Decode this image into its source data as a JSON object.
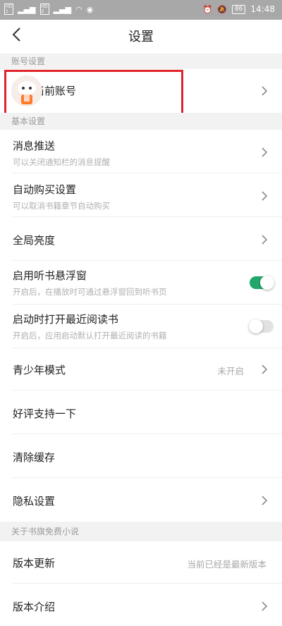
{
  "status_bar": {
    "hd1": "HD",
    "hd1_sub": "1",
    "hd2": "HD",
    "hd2_sub": "2",
    "signal1": "4G",
    "battery": "86",
    "time": "14:48"
  },
  "header": {
    "title": "设置"
  },
  "sections": {
    "account": "账号设置",
    "basic": "基本设置",
    "about": "关于书旗免费小说"
  },
  "account": {
    "logout_label": "退出当前账号"
  },
  "settings": {
    "push": {
      "label": "消息推送",
      "sub": "可以关闭通知栏的消息提醒"
    },
    "autobuy": {
      "label": "自动购买设置",
      "sub": "可以取消书籍章节自动购买"
    },
    "brightness": {
      "label": "全局亮度"
    },
    "float": {
      "label": "启用听书悬浮窗",
      "sub": "开启后，在播放时可通过悬浮窗回到听书页",
      "on": true
    },
    "recent": {
      "label": "启动时打开最近阅读书",
      "sub": "开启后，应用启动默认打开最近阅读的书籍",
      "on": false
    },
    "teen": {
      "label": "青少年模式",
      "value": "未开启"
    },
    "rate": {
      "label": "好评支持一下"
    },
    "cache": {
      "label": "清除缓存"
    },
    "privacy": {
      "label": "隐私设置"
    }
  },
  "about": {
    "update": {
      "label": "版本更新",
      "value": "当前已经是最新版本"
    },
    "intro": {
      "label": "版本介绍"
    }
  },
  "colors": {
    "toggle_on": "#22a66b",
    "highlight": "#e0232b"
  }
}
